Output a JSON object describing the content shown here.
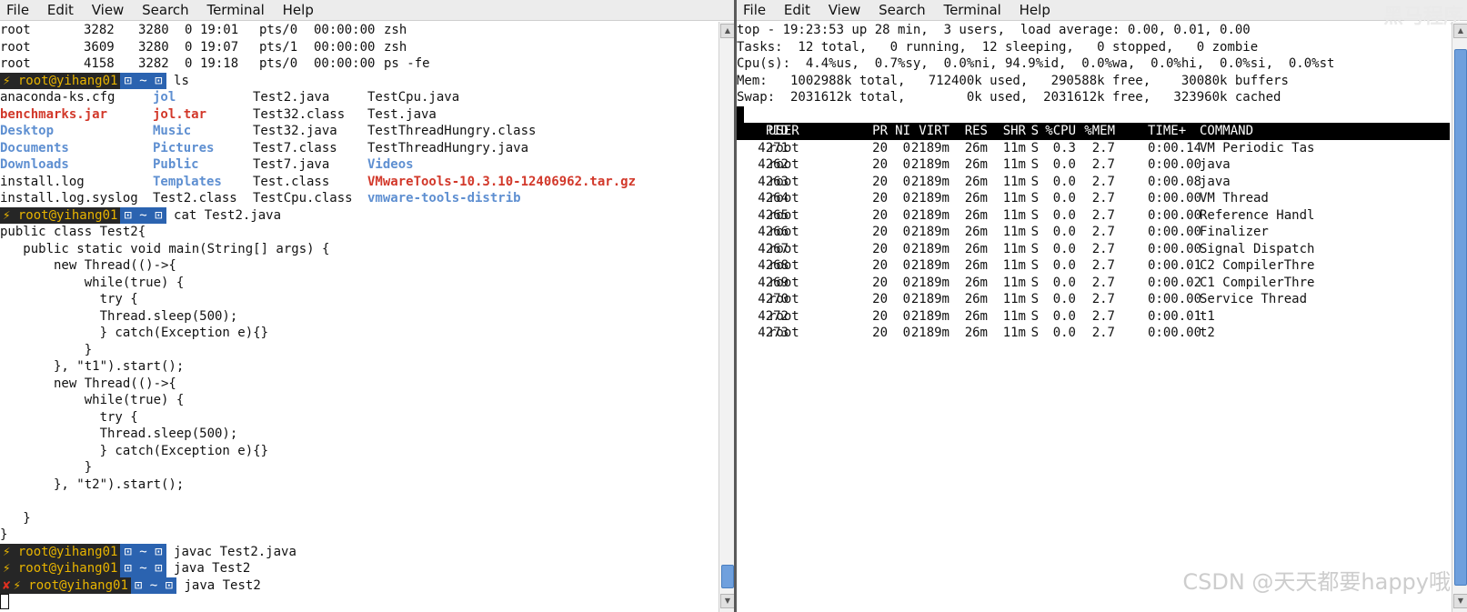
{
  "menus": [
    "File",
    "Edit",
    "View",
    "Search",
    "Terminal",
    "Help"
  ],
  "left_terminal": {
    "ps_rows": [
      [
        "root",
        "3282",
        "3280",
        "0",
        "19:01",
        "pts/0",
        "00:00:00",
        "zsh"
      ],
      [
        "root",
        "3609",
        "3280",
        "0",
        "19:07",
        "pts/1",
        "00:00:00",
        "zsh"
      ],
      [
        "root",
        "4158",
        "3282",
        "0",
        "19:18",
        "pts/0",
        "00:00:00",
        "ps -fe"
      ]
    ],
    "prompt_user": "⚡ root@yihang01",
    "prompt_dir": "⊡ ~ ⊡",
    "error_mark": "✘",
    "cmd_ls": "ls",
    "ls_rows": [
      [
        {
          "t": "anaconda-ks.cfg",
          "c": ""
        },
        {
          "t": "jol",
          "c": "blue"
        },
        {
          "t": "Test2.java",
          "c": ""
        },
        {
          "t": "TestCpu.java",
          "c": ""
        }
      ],
      [
        {
          "t": "benchmarks.jar",
          "c": "red"
        },
        {
          "t": "jol.tar",
          "c": "red"
        },
        {
          "t": "Test32.class",
          "c": ""
        },
        {
          "t": "Test.java",
          "c": ""
        }
      ],
      [
        {
          "t": "Desktop",
          "c": "blue"
        },
        {
          "t": "Music",
          "c": "blue"
        },
        {
          "t": "Test32.java",
          "c": ""
        },
        {
          "t": "TestThreadHungry.class",
          "c": ""
        }
      ],
      [
        {
          "t": "Documents",
          "c": "blue"
        },
        {
          "t": "Pictures",
          "c": "blue"
        },
        {
          "t": "Test7.class",
          "c": ""
        },
        {
          "t": "TestThreadHungry.java",
          "c": ""
        }
      ],
      [
        {
          "t": "Downloads",
          "c": "blue"
        },
        {
          "t": "Public",
          "c": "blue"
        },
        {
          "t": "Test7.java",
          "c": ""
        },
        {
          "t": "Videos",
          "c": "blue"
        }
      ],
      [
        {
          "t": "install.log",
          "c": ""
        },
        {
          "t": "Templates",
          "c": "blue"
        },
        {
          "t": "Test.class",
          "c": ""
        },
        {
          "t": "VMwareTools-10.3.10-12406962.tar.gz",
          "c": "red"
        }
      ],
      [
        {
          "t": "install.log.syslog",
          "c": ""
        },
        {
          "t": "Test2.class",
          "c": ""
        },
        {
          "t": "TestCpu.class",
          "c": ""
        },
        {
          "t": "vmware-tools-distrib",
          "c": "blue"
        }
      ]
    ],
    "cmd_cat": "cat Test2.java",
    "code_lines": [
      "public class Test2{",
      "   public static void main(String[] args) {",
      "       new Thread(()->{",
      "           while(true) {",
      "             try {",
      "             Thread.sleep(500);",
      "             } catch(Exception e){}",
      "           }",
      "       }, \"t1\").start();",
      "       new Thread(()->{",
      "           while(true) {",
      "             try {",
      "             Thread.sleep(500);",
      "             } catch(Exception e){}",
      "           }",
      "       }, \"t2\").start();",
      "",
      "   }",
      "}"
    ],
    "cmd_javac": "javac Test2.java",
    "cmd_java_1": "java Test2",
    "cmd_java_2": "java Test2"
  },
  "right_terminal": {
    "summary": [
      "top - 19:23:53 up 28 min,  3 users,  load average: 0.00, 0.01, 0.00",
      "Tasks:  12 total,   0 running,  12 sleeping,   0 stopped,   0 zombie",
      "Cpu(s):  4.4%us,  0.7%sy,  0.0%ni, 94.9%id,  0.0%wa,  0.0%hi,  0.0%si,  0.0%st",
      "Mem:   1002988k total,   712400k used,   290588k free,    30080k buffers",
      "Swap:  2031612k total,        0k used,  2031612k free,   323960k cached"
    ],
    "header": [
      "PID",
      "USER",
      "PR",
      "NI",
      "VIRT",
      "RES",
      "SHR",
      "S",
      "%CPU",
      "%MEM",
      "TIME+",
      "COMMAND"
    ],
    "rows": [
      [
        "4271",
        "root",
        "20",
        "0",
        "2189m",
        "26m",
        "11m",
        "S",
        "0.3",
        "2.7",
        "0:00.14",
        "VM Periodic Tas"
      ],
      [
        "4262",
        "root",
        "20",
        "0",
        "2189m",
        "26m",
        "11m",
        "S",
        "0.0",
        "2.7",
        "0:00.00",
        "java"
      ],
      [
        "4263",
        "root",
        "20",
        "0",
        "2189m",
        "26m",
        "11m",
        "S",
        "0.0",
        "2.7",
        "0:00.08",
        "java"
      ],
      [
        "4264",
        "root",
        "20",
        "0",
        "2189m",
        "26m",
        "11m",
        "S",
        "0.0",
        "2.7",
        "0:00.00",
        "VM Thread"
      ],
      [
        "4265",
        "root",
        "20",
        "0",
        "2189m",
        "26m",
        "11m",
        "S",
        "0.0",
        "2.7",
        "0:00.00",
        "Reference Handl"
      ],
      [
        "4266",
        "root",
        "20",
        "0",
        "2189m",
        "26m",
        "11m",
        "S",
        "0.0",
        "2.7",
        "0:00.00",
        "Finalizer"
      ],
      [
        "4267",
        "root",
        "20",
        "0",
        "2189m",
        "26m",
        "11m",
        "S",
        "0.0",
        "2.7",
        "0:00.00",
        "Signal Dispatch"
      ],
      [
        "4268",
        "root",
        "20",
        "0",
        "2189m",
        "26m",
        "11m",
        "S",
        "0.0",
        "2.7",
        "0:00.01",
        "C2 CompilerThre"
      ],
      [
        "4269",
        "root",
        "20",
        "0",
        "2189m",
        "26m",
        "11m",
        "S",
        "0.0",
        "2.7",
        "0:00.02",
        "C1 CompilerThre"
      ],
      [
        "4270",
        "root",
        "20",
        "0",
        "2189m",
        "26m",
        "11m",
        "S",
        "0.0",
        "2.7",
        "0:00.00",
        "Service Thread"
      ],
      [
        "4272",
        "root",
        "20",
        "0",
        "2189m",
        "26m",
        "11m",
        "S",
        "0.0",
        "2.7",
        "0:00.01",
        "t1"
      ],
      [
        "4273",
        "root",
        "20",
        "0",
        "2189m",
        "26m",
        "11m",
        "S",
        "0.0",
        "2.7",
        "0:00.00",
        "t2"
      ]
    ]
  },
  "watermark": "CSDN @天天都要happy哦",
  "logo_text": "黑马程序"
}
